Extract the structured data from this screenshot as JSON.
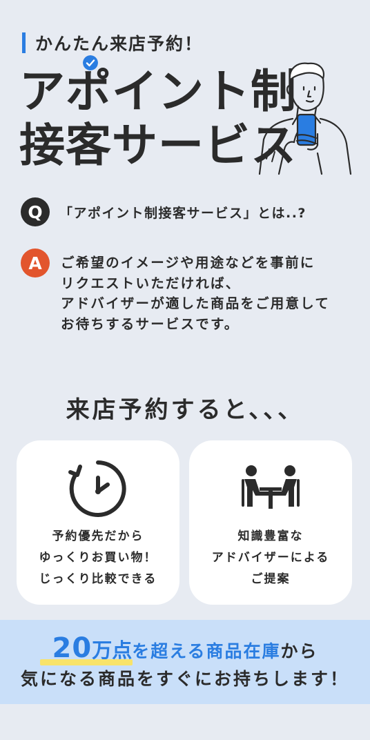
{
  "eyebrow": {
    "text": "かんたん来店予約！"
  },
  "title": {
    "line1": "アポイント制",
    "line2": "接客サービス"
  },
  "qa": {
    "q_mark": "Q",
    "question": "「アポイント制接客サービス」とは..?",
    "a_mark": "A",
    "answer_lines": [
      "ご希望のイメージや用途などを事前に",
      "リクエストいただければ、",
      "アドバイザーが適した商品をご用意して",
      "お待ちするサービスです。"
    ]
  },
  "section": {
    "heading": "来店予約すると、、、"
  },
  "cards": [
    {
      "icon": "clock-icon",
      "lines": [
        "予約優先だから",
        "ゆっくりお買い物！",
        "じっくり比較できる"
      ]
    },
    {
      "icon": "consultation-icon",
      "lines": [
        "知識豊富な",
        "アドバイザーによる",
        "ご提案"
      ]
    }
  ],
  "band": {
    "number": "20",
    "unit": "万点",
    "mid_text": "を超える商品在庫",
    "tail_text": "から",
    "line2": "気になる商品をすぐにお持ちします！"
  },
  "colors": {
    "accent_blue": "#2a7de1",
    "accent_orange": "#e2552d",
    "highlight_yellow": "#f8e36a",
    "band_bg": "#c9dff9"
  }
}
